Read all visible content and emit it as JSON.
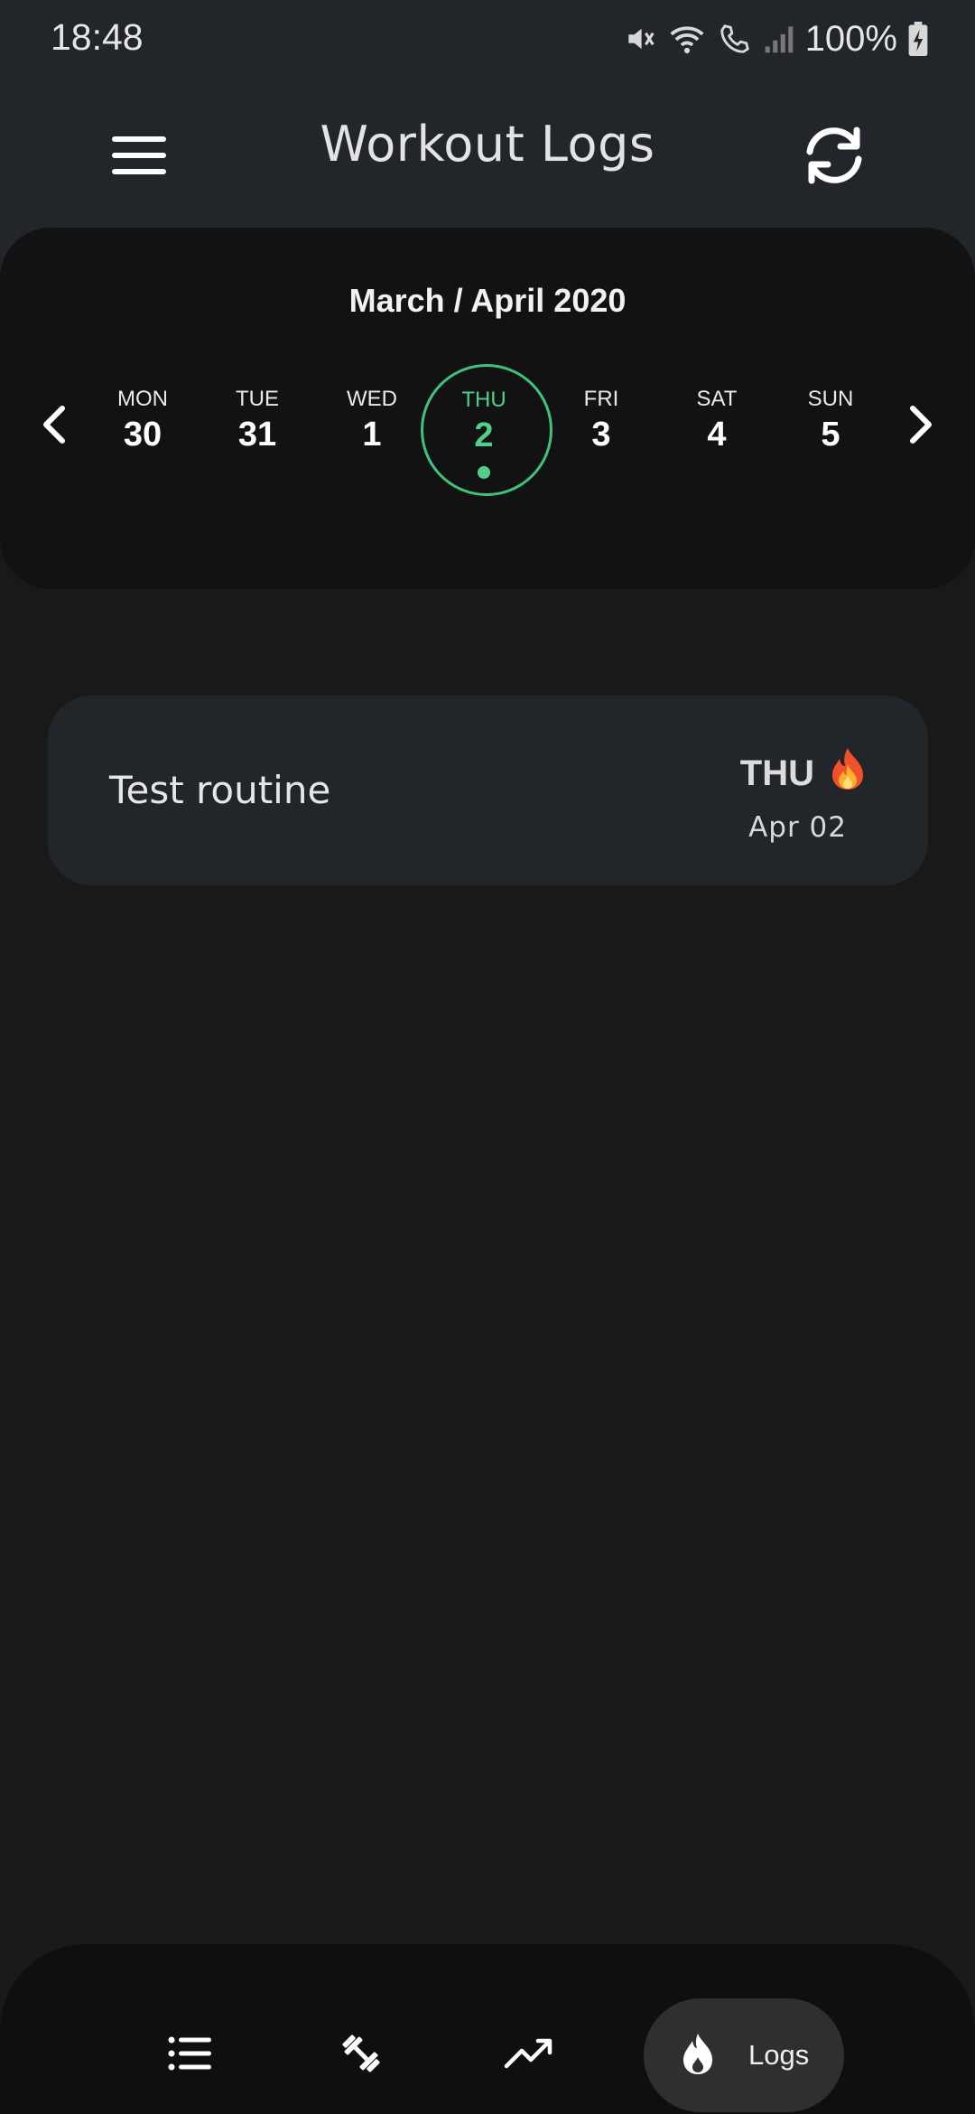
{
  "status_bar": {
    "time": "18:48",
    "battery": "100%",
    "icons": [
      "mute-icon",
      "wifi-icon",
      "call-icon",
      "signal-icon",
      "battery-charging-icon"
    ]
  },
  "app_bar": {
    "title": "Workout Logs",
    "menu_icon": "hamburger-menu-icon",
    "refresh_icon": "refresh-icon"
  },
  "calendar": {
    "month_label": "March / April 2020",
    "days": [
      {
        "name": "MON",
        "num": "30"
      },
      {
        "name": "TUE",
        "num": "31"
      },
      {
        "name": "WED",
        "num": "1"
      },
      {
        "name": "THU",
        "num": "2",
        "selected": true,
        "has_log": true
      },
      {
        "name": "FRI",
        "num": "3"
      },
      {
        "name": "SAT",
        "num": "4"
      },
      {
        "name": "SUN",
        "num": "5"
      }
    ],
    "accent_color": "#4fd08a"
  },
  "logs": [
    {
      "name": "Test routine",
      "day": "THU",
      "emoji": "🔥",
      "date": "Apr 02"
    }
  ],
  "bottom_nav": {
    "items": [
      {
        "icon": "list-icon"
      },
      {
        "icon": "dumbbell-icon"
      },
      {
        "icon": "trending-up-icon"
      },
      {
        "icon": "flame-icon",
        "label": "Logs",
        "active": true
      }
    ]
  }
}
